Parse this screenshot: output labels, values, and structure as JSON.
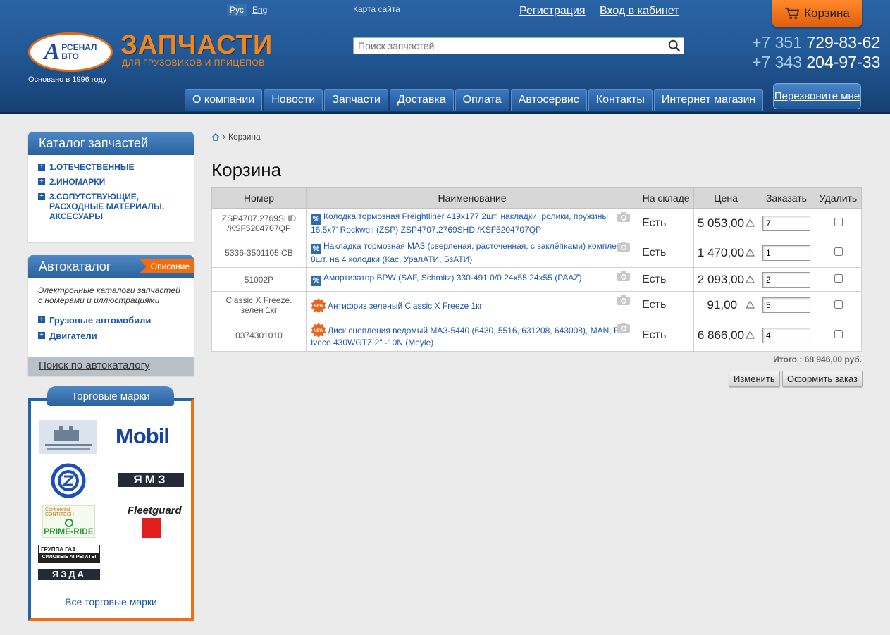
{
  "header": {
    "lang_ru": "Рус",
    "lang_en": "Eng",
    "sitemap": "Карта сайта",
    "register": "Регистрация",
    "login": "Вход в кабинет",
    "cart_label": "Корзина",
    "logo_big": "А",
    "logo_top": "РСЕНАЛ",
    "logo_bottom": "ВТО",
    "founded": "Основано в 1996 году",
    "brand": "ЗАПЧАСТИ",
    "brand_sub": "ДЛЯ ГРУЗОВИКОВ И ПРИЦЕПОВ",
    "search_placeholder": "Поиск запчастей",
    "phones": [
      {
        "code": "+7 351",
        "number": "729-83-62"
      },
      {
        "code": "+7 343",
        "number": "204-97-33"
      }
    ],
    "callback": "Перезвоните мне"
  },
  "nav": [
    "О компании",
    "Новости",
    "Запчасти",
    "Доставка",
    "Оплата",
    "Автосервис",
    "Контакты",
    "Интернет магазин"
  ],
  "sidebar": {
    "catalog_title": "Каталог запчастей",
    "catalog_items": [
      "1.ОТЕЧЕСТВЕННЫЕ",
      "2.ИНОМАРКИ",
      "3.СОПУТСТВУЮЩИЕ, РАСХОДНЫЕ МАТЕРИАЛЫ, АКСЕСУАРЫ"
    ],
    "autocat_title": "Автокаталог",
    "autocat_badge": "Описание",
    "autocat_desc": "Электронные каталоги запчастей с номерами и иллюстрациями",
    "autocat_items": [
      "Грузовые автомобили",
      "Двигатели"
    ],
    "autocat_search": "Поиск по автокаталогу",
    "brands_title": "Торговые марки",
    "brands_all": "Все торговые марки",
    "brand_logos": [
      "Mobil",
      "ЯМЗ",
      "Fleetguard",
      "PRIME-RIDE",
      "ГРУППА ГАЗ",
      "СИЛОВЫЕ АГРЕГАТЫ",
      "ЯЗДА"
    ]
  },
  "breadcrumb": {
    "current": "Корзина"
  },
  "page_title": "Корзина",
  "table": {
    "headers": [
      "Номер",
      "Наименование",
      "На складе",
      "Цена",
      "Заказать",
      "Удалить"
    ],
    "rows": [
      {
        "num": "ZSP4707.2769SHD /KSF5204707QP",
        "name": "Колодка тормозная Freightliner 419х177 2шт. накладки, ролики, пружины 16.5x7' Rockwell (ZSP) ZSP4707.2769SHD /KSF5204707QP",
        "badge": "pct",
        "stock": "Есть",
        "price": "5 053,00",
        "qty": "7"
      },
      {
        "num": "5336-3501105 СВ",
        "name": "Накладка тормозная МАЗ (сверленая, расточенная, с заклёпками) комплект 8шт. на 4 колодки (Кас, УралАТИ, БзАТИ)",
        "badge": "pct",
        "stock": "Есть",
        "price": "1 470,00",
        "qty": "1"
      },
      {
        "num": "51002P",
        "name": "Амортизатор BPW (SAF, Schmitz) 330-491 0/0 24х55 24х55 (PAAZ)",
        "badge": "pct",
        "stock": "Есть",
        "price": "2 093,00",
        "qty": "2"
      },
      {
        "num": "Classic X Freeze. зелен 1кг",
        "name": "Антифриз зеленый Classic X Freeze 1кг",
        "badge": "new",
        "stock": "Есть",
        "price": "91,00",
        "qty": "5"
      },
      {
        "num": "0374301010",
        "name": "Диск сцепления ведомый МАЗ-5440 (6430, 5516, 631208, 643008), MAN, RVI, Iveco 430WGTZ 2\" -10N (Meyle)",
        "badge": "new",
        "stock": "Есть",
        "price": "6 866,00",
        "qty": "4"
      }
    ]
  },
  "total": "Итого : 68 946,00 руб.",
  "buttons": {
    "change": "Изменить",
    "order": "Оформить заказ"
  },
  "colors": {
    "accent": "#f06e12",
    "header": "#225996",
    "link": "#1c57a8"
  }
}
